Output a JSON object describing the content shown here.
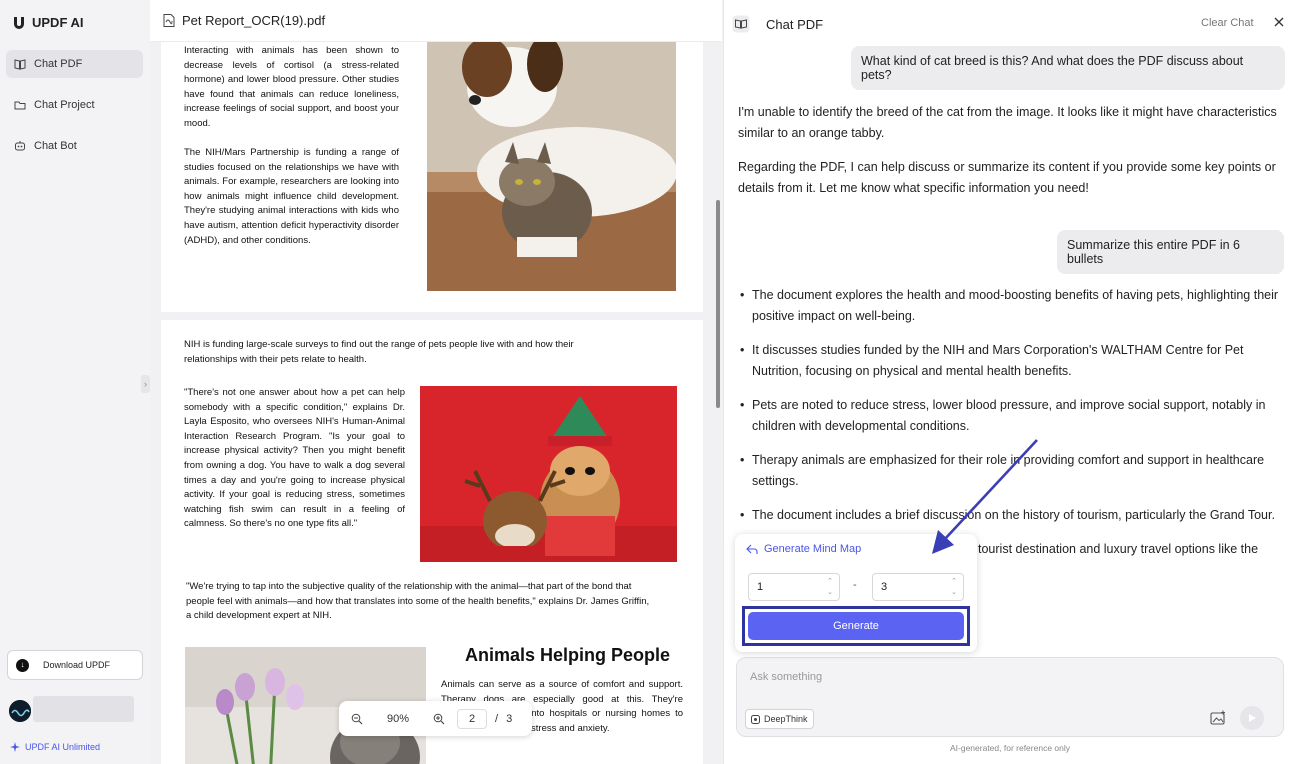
{
  "app": {
    "brand": "UPDF AI"
  },
  "sidebar": {
    "items": [
      {
        "label": "Chat PDF",
        "icon": "book-icon",
        "active": true
      },
      {
        "label": "Chat Project",
        "icon": "folder-icon",
        "active": false
      },
      {
        "label": "Chat Bot",
        "icon": "bot-icon",
        "active": false
      }
    ],
    "download_label": "Download UPDF",
    "unlimited_label": "UPDF AI Unlimited"
  },
  "viewer": {
    "file_name": "Pet Report_OCR(19).pdf",
    "page1": {
      "para1": "Interacting with animals has been shown to decrease levels of cortisol (a stress-related hormone) and lower blood pressure. Other studies have found that animals can reduce loneliness, increase feelings of social support, and boost your mood.",
      "para2": "The NIH/Mars Partnership is funding a range of studies focused on the relationships we have with animals. For example, researchers are looking into how animals might influence child development. They're studying animal interactions with kids who have autism, attention deficit hyperactivity disorder (ADHD), and other conditions."
    },
    "page2": {
      "intro": "NIH is funding large-scale surveys to find out the range of pets people live with and how their relationships with their pets relate to health.",
      "quote1": "\"There's not one answer about how a pet can help somebody with a specific condition,\" explains Dr. Layla Esposito, who oversees NIH's Human-Animal Interaction Research Program. \"Is your goal to increase physical activity? Then you might benefit from owning a dog. You have to walk a dog several times a day and you're going to increase physical activity. If your goal is reducing stress, sometimes watching fish swim can result in a feeling of calmness. So there's no one type fits all.\"",
      "quote2": "\"We're trying to tap into the subjective quality of the relationship with the animal—that part of the bond that people feel with animals—and how that translates into some of the health benefits,\" explains Dr. James Griffin, a child development expert at NIH.",
      "heading": "Animals Helping People",
      "para3": "Animals can serve as a source of comfort and support. Therapy dogs are especially good at this. They're sometimes brought into hospitals or nursing homes to help reduce patients' stress and anxiety."
    },
    "zoom": "90%",
    "page_current": "2",
    "page_total": "3"
  },
  "chat": {
    "title": "Chat PDF",
    "clear_label": "Clear Chat",
    "user_msg1": "What kind of cat breed is this? And what does the PDF discuss about pets?",
    "ai_msg1_p1": "I'm unable to identify the breed of the cat from the image. It looks like it might have characteristics similar to an orange tabby.",
    "ai_msg1_p2": "Regarding the PDF, I can help discuss or summarize its content if you provide some key points or details from it. Let me know what specific information you need!",
    "user_msg2": "Summarize this entire PDF in 6 bullets",
    "bullets": [
      "The document explores the health and mood-boosting benefits of having pets, highlighting their positive impact on well-being.",
      "It discusses studies funded by the NIH and Mars Corporation's WALTHAM Centre for Pet Nutrition, focusing on physical and mental health benefits.",
      "Pets are noted to reduce stress, lower blood pressure, and improve social support, notably in children with developmental conditions.",
      "Therapy animals are emphasized for their role in providing comfort and support in healthcare settings.",
      "The document includes a brief discussion on the history of tourism, particularly the Grand Tour."
    ],
    "bullet6_partial": "tourist destination and luxury travel options like the",
    "mindmap": {
      "title": "Generate Mind Map",
      "from": "1",
      "to": "3",
      "dash": "-",
      "generate_label": "Generate"
    },
    "input_placeholder": "Ask something",
    "deepthink_label": "DeepThink",
    "disclaimer": "AI-generated, for reference only"
  },
  "colors": {
    "accent": "#5b63f2",
    "highlight_outline": "#2d34a0",
    "arrow": "#3a3fb5"
  }
}
